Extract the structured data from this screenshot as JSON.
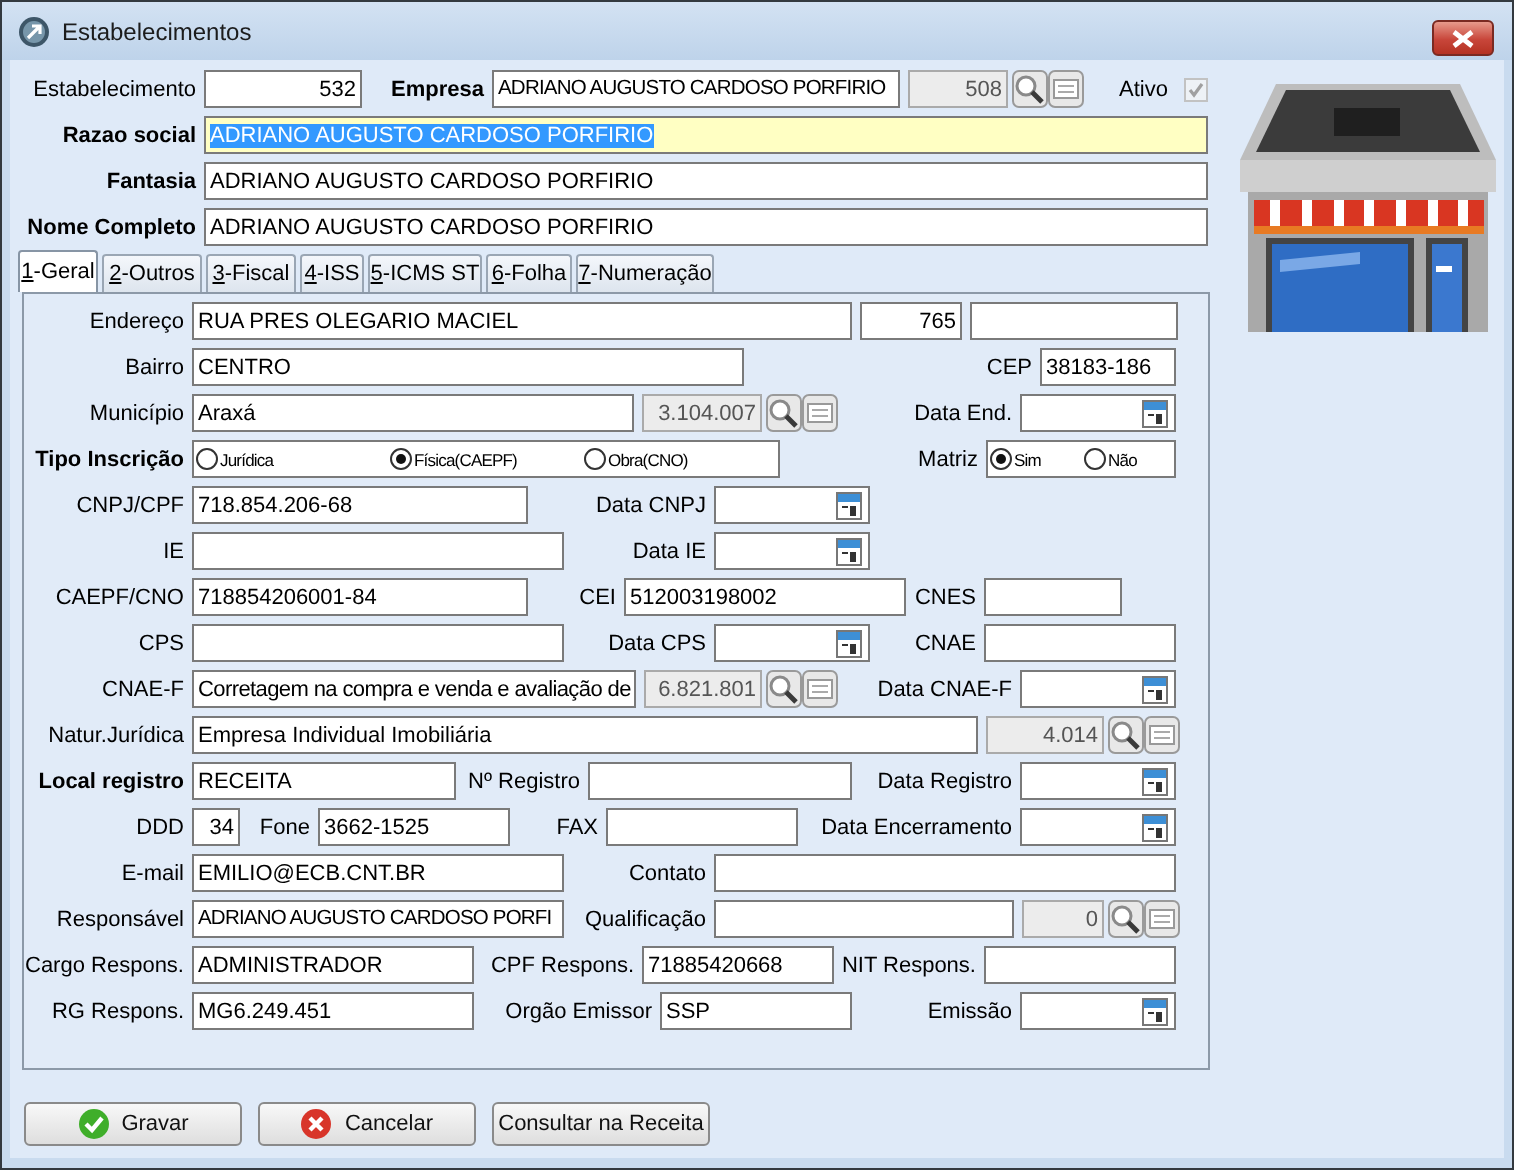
{
  "window": {
    "title": "Estabelecimentos"
  },
  "header_rows": [
    [
      {
        "kind": "text",
        "label": "Estabelecimento",
        "value": "532",
        "required": false,
        "focused": false
      },
      {
        "kind": "lookup",
        "label": "Empresa",
        "value": "ADRIANO AUGUSTO CARDOSO PORFIRIO",
        "code": "508",
        "required": true,
        "focused": false
      },
      {
        "kind": "checkbox",
        "label": "Ativo",
        "checked": true,
        "disabled": true
      }
    ],
    [
      {
        "kind": "text",
        "label": "Razao social",
        "value": "ADRIANO AUGUSTO CARDOSO PORFIRIO",
        "required": true,
        "focused": true
      }
    ],
    [
      {
        "kind": "text",
        "label": "Fantasia",
        "value": "ADRIANO AUGUSTO CARDOSO PORFIRIO",
        "required": true,
        "focused": false
      }
    ],
    [
      {
        "kind": "text",
        "label": "Nome Completo",
        "value": "ADRIANO AUGUSTO CARDOSO PORFIRIO",
        "required": true,
        "focused": false
      }
    ]
  ],
  "tabs": [
    {
      "label": "1-Geral",
      "selected": true
    },
    {
      "label": "2-Outros",
      "selected": false
    },
    {
      "label": "3-Fiscal",
      "selected": false
    },
    {
      "label": "4-ISS",
      "selected": false
    },
    {
      "label": "5-ICMS ST",
      "selected": false
    },
    {
      "label": "6-Folha",
      "selected": false
    },
    {
      "label": "7-Numeração",
      "selected": false
    }
  ],
  "tab_rows": [
    [
      {
        "kind": "text",
        "label": "Endereço",
        "value": "RUA PRES OLEGARIO MACIEL",
        "required": false
      },
      {
        "kind": "text",
        "value": "765"
      },
      {
        "kind": "text"
      }
    ],
    [
      {
        "kind": "text",
        "label": "Bairro",
        "value": "CENTRO",
        "required": false
      },
      {
        "kind": "text",
        "label": "CEP",
        "value": "38183-186",
        "required": false
      }
    ],
    [
      {
        "kind": "lookup",
        "label": "Município",
        "value": "Araxá",
        "code": "3.104.007",
        "required": false
      },
      {
        "kind": "date",
        "label": "Data End.",
        "required": false
      }
    ],
    [
      {
        "kind": "radio",
        "label": "Tipo Inscrição",
        "required": true,
        "options": [
          {
            "label": "Jurídica",
            "selected": false
          },
          {
            "label": "Física(CAEPF)",
            "selected": true
          },
          {
            "label": "Obra(CNO)",
            "selected": false
          }
        ]
      },
      {
        "kind": "radio",
        "label": "Matriz",
        "required": false,
        "options": [
          {
            "label": "Sim",
            "selected": true
          },
          {
            "label": "Não",
            "selected": false
          }
        ]
      }
    ],
    [
      {
        "kind": "text",
        "label": "CNPJ/CPF",
        "value": "718.854.206-68",
        "required": false
      },
      {
        "kind": "date",
        "label": "Data CNPJ",
        "required": false
      }
    ],
    [
      {
        "kind": "text",
        "label": "IE",
        "required": false
      },
      {
        "kind": "date",
        "label": "Data IE",
        "required": false
      }
    ],
    [
      {
        "kind": "text",
        "label": "CAEPF/CNO",
        "value": "718854206001-84",
        "required": false
      },
      {
        "kind": "text",
        "label": "CEI",
        "value": "512003198002",
        "required": false
      },
      {
        "kind": "text",
        "label": "CNES",
        "required": false
      }
    ],
    [
      {
        "kind": "text",
        "label": "CPS",
        "required": false
      },
      {
        "kind": "date",
        "label": "Data CPS",
        "required": false
      },
      {
        "kind": "text",
        "label": "CNAE",
        "required": false
      }
    ],
    [
      {
        "kind": "lookup",
        "label": "CNAE-F",
        "value": "Corretagem na compra e venda e avaliação de",
        "code": "6.821.801",
        "required": false
      },
      {
        "kind": "date",
        "label": "Data CNAE-F",
        "required": false
      }
    ],
    [
      {
        "kind": "lookup",
        "label": "Natur.Jurídica",
        "value": "Empresa Individual Imobiliária",
        "code": "4.014",
        "required": false
      }
    ],
    [
      {
        "kind": "text",
        "label": "Local registro",
        "value": "RECEITA",
        "required": true
      },
      {
        "kind": "text",
        "label": "Nº Registro",
        "required": false
      },
      {
        "kind": "date",
        "label": "Data Registro",
        "required": false
      }
    ],
    [
      {
        "kind": "text",
        "label": "DDD",
        "value": "34",
        "required": false
      },
      {
        "kind": "text",
        "label": "Fone",
        "value": "3662-1525",
        "required": false
      },
      {
        "kind": "text",
        "label": "FAX",
        "required": false
      },
      {
        "kind": "date",
        "label": "Data Encerramento",
        "required": false
      }
    ],
    [
      {
        "kind": "text",
        "label": "E-mail",
        "value": "EMILIO@ECB.CNT.BR",
        "required": false
      },
      {
        "kind": "text",
        "label": "Contato",
        "required": false
      }
    ],
    [
      {
        "kind": "text",
        "label": "Responsável",
        "value": "ADRIANO AUGUSTO CARDOSO PORFI",
        "required": false
      },
      {
        "kind": "lookup",
        "label": "Qualificação",
        "code": "0",
        "required": false
      }
    ],
    [
      {
        "kind": "text",
        "label": "Cargo Respons.",
        "value": "ADMINISTRADOR",
        "required": false
      },
      {
        "kind": "text",
        "label": "CPF Respons.",
        "value": "71885420668",
        "required": false
      },
      {
        "kind": "text",
        "label": "NIT Respons.",
        "required": false
      }
    ],
    [
      {
        "kind": "text",
        "label": "RG Respons.",
        "value": "MG6.249.451",
        "required": false
      },
      {
        "kind": "text",
        "label": "Orgão Emissor",
        "value": "SSP",
        "required": false
      },
      {
        "kind": "date",
        "label": "Emissão",
        "required": false
      }
    ]
  ],
  "buttons": [
    {
      "label": "Gravar",
      "kind": "confirm"
    },
    {
      "label": "Cancelar",
      "kind": "cancel"
    },
    {
      "label": "Consultar na Receita",
      "kind": "plain"
    }
  ]
}
